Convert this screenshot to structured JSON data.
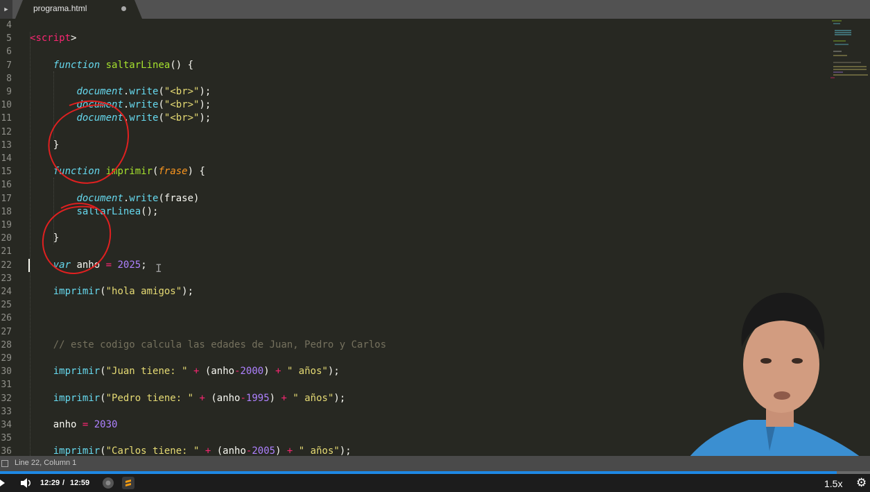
{
  "tab": {
    "title": "programa.html"
  },
  "editor": {
    "lines": [
      {
        "n": "4",
        "html": ""
      },
      {
        "n": "5",
        "html": "<span class=\"tag\">&lt;</span><span class=\"tag\">script</span><span>&gt;</span>"
      },
      {
        "n": "6",
        "html": ""
      },
      {
        "n": "7",
        "html": "    <span class=\"kw\">function</span> <span class=\"fn\">saltarLinea</span>() {"
      },
      {
        "n": "8",
        "html": ""
      },
      {
        "n": "9",
        "html": "        <span class=\"kw\">document</span>.<span class=\"kw\" style=\"font-style:normal\">write</span>(<span class=\"str\">\"&lt;br&gt;\"</span>);"
      },
      {
        "n": "10",
        "html": "        <span class=\"kw\">document</span>.<span class=\"kw\" style=\"font-style:normal\">write</span>(<span class=\"str\">\"&lt;br&gt;\"</span>);"
      },
      {
        "n": "11",
        "html": "        <span class=\"kw\">document</span>.<span class=\"kw\" style=\"font-style:normal\">write</span>(<span class=\"str\">\"&lt;br&gt;\"</span>);"
      },
      {
        "n": "12",
        "html": ""
      },
      {
        "n": "13",
        "html": "    }"
      },
      {
        "n": "14",
        "html": ""
      },
      {
        "n": "15",
        "html": "    <span class=\"kw\">function</span> <span class=\"fn\">imprimir</span>(<span class=\"par\">frase</span>) {"
      },
      {
        "n": "16",
        "html": ""
      },
      {
        "n": "17",
        "html": "        <span class=\"kw\">document</span>.<span class=\"kw\" style=\"font-style:normal\">write</span>(frase)"
      },
      {
        "n": "18",
        "html": "        <span class=\"kw\" style=\"font-style:normal\">saltarLinea</span>();"
      },
      {
        "n": "19",
        "html": ""
      },
      {
        "n": "20",
        "html": "    }"
      },
      {
        "n": "21",
        "html": ""
      },
      {
        "n": "22",
        "html": "    <span class=\"kw\">var</span> anho <span class=\"op\">=</span> <span class=\"num\">2025</span>;"
      },
      {
        "n": "23",
        "html": ""
      },
      {
        "n": "24",
        "html": "    <span class=\"kw\" style=\"font-style:normal\">imprimir</span>(<span class=\"str\">\"hola amigos\"</span>);"
      },
      {
        "n": "25",
        "html": ""
      },
      {
        "n": "26",
        "html": ""
      },
      {
        "n": "27",
        "html": ""
      },
      {
        "n": "28",
        "html": "    <span class=\"cm\">// este codigo calcula las edades de Juan, Pedro y Carlos</span>"
      },
      {
        "n": "29",
        "html": ""
      },
      {
        "n": "30",
        "html": "    <span class=\"kw\" style=\"font-style:normal\">imprimir</span>(<span class=\"str\">\"Juan tiene: \"</span> <span class=\"op\">+</span> (anho<span class=\"op\">-</span><span class=\"num\">2000</span>) <span class=\"op\">+</span> <span class=\"str\">\" años\"</span>);"
      },
      {
        "n": "31",
        "html": ""
      },
      {
        "n": "32",
        "html": "    <span class=\"kw\" style=\"font-style:normal\">imprimir</span>(<span class=\"str\">\"Pedro tiene: \"</span> <span class=\"op\">+</span> (anho<span class=\"op\">-</span><span class=\"num\">1995</span>) <span class=\"op\">+</span> <span class=\"str\">\" años\"</span>);"
      },
      {
        "n": "33",
        "html": ""
      },
      {
        "n": "34",
        "html": "    anho <span class=\"op\">=</span> <span class=\"num\">2030</span>"
      },
      {
        "n": "35",
        "html": ""
      },
      {
        "n": "36",
        "html": "    <span class=\"kw\" style=\"font-style:normal\">imprimir</span>(<span class=\"str\">\"Carlos tiene: \"</span> <span class=\"op\">+</span> (anho<span class=\"op\">-</span><span class=\"num\">2005</span>) <span class=\"op\">+</span> <span class=\"str\">\" años\"</span>);"
      }
    ]
  },
  "status": {
    "text": "Line 22, Column 1"
  },
  "player": {
    "current_time": "12:29",
    "separator": "/",
    "duration": "12:59",
    "speed": "1.5x",
    "progress_fraction": 0.962
  },
  "icons": {
    "play": "play-icon",
    "volume": "volume-icon",
    "settings": "gear-icon",
    "browser": "chrome-icon",
    "editor_app": "sublime-icon"
  },
  "colors": {
    "background": "#272822",
    "keyword": "#66d9ef",
    "function": "#a6e22e",
    "string": "#e6db74",
    "operator": "#f92672",
    "number": "#ae81ff",
    "comment": "#75715e",
    "annotation": "#e02020",
    "progress": "#1e88e5"
  }
}
